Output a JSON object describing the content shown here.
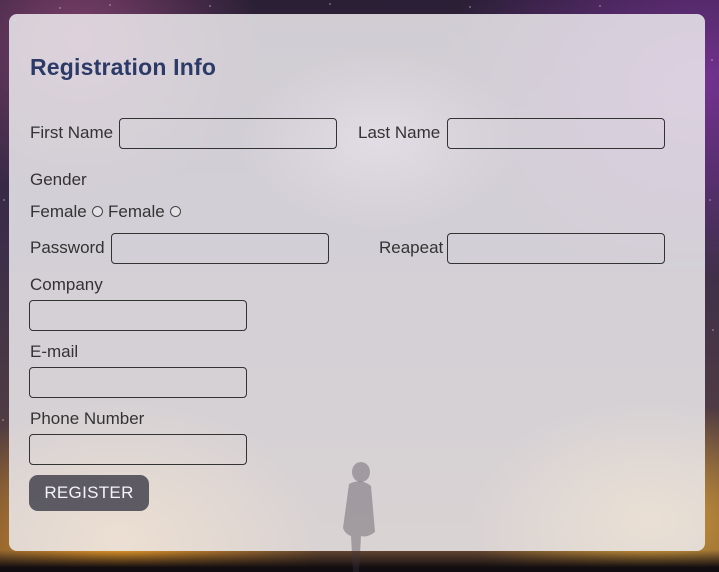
{
  "form": {
    "title": "Registration Info",
    "first_name_label": "First Name",
    "last_name_label": "Last Name",
    "gender_label": "Gender",
    "gender_options": [
      "Female",
      "Female"
    ],
    "password_label": "Password",
    "repeat_label": "Reapeat",
    "company_label": "Company",
    "email_label": "E-mail",
    "phone_label": "Phone Number",
    "register_label": "REGISTER",
    "first_name_value": "",
    "last_name_value": "",
    "password_value": "",
    "repeat_value": "",
    "company_value": "",
    "email_value": "",
    "phone_value": ""
  },
  "colors": {
    "title": "#2b3a66",
    "panel": "rgba(236,234,238,0.86)",
    "button_bg": "rgba(40,40,55,0.72)",
    "button_text": "#f4f4f8"
  }
}
